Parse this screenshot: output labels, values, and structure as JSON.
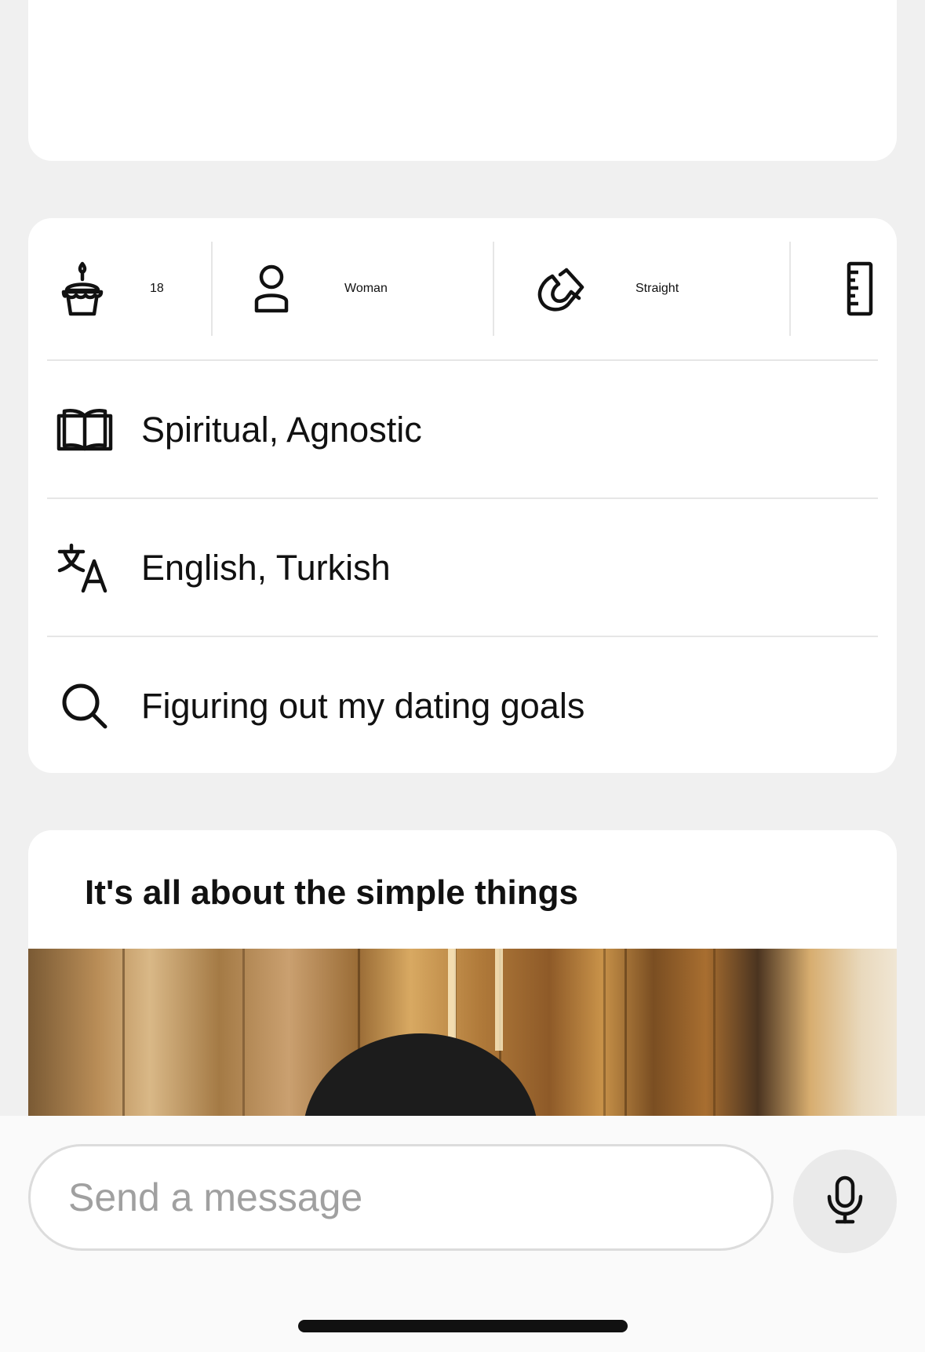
{
  "profile_basics": {
    "age": "18",
    "gender": "Woman",
    "sexuality": "Straight"
  },
  "profile_rows": {
    "religion": "Spiritual, Agnostic",
    "languages": "English, Turkish",
    "dating_intention": "Figuring out my dating goals"
  },
  "prompt_card": {
    "title": "It's all about the simple things"
  },
  "composer": {
    "placeholder": "Send a message",
    "value": ""
  },
  "icons": {
    "age": "birthday-cake-icon",
    "gender": "person-icon",
    "sexuality": "magnet-icon",
    "height": "ruler-icon",
    "religion": "book-icon",
    "languages": "translate-icon",
    "dating_intention": "search-icon",
    "mic": "microphone-icon"
  },
  "colors": {
    "page_background": "#f0f0f0",
    "card_background": "#ffffff",
    "divider": "#e6e6e6",
    "text": "#111111",
    "placeholder": "#a0a0a0",
    "mic_button": "#eaeaea"
  }
}
